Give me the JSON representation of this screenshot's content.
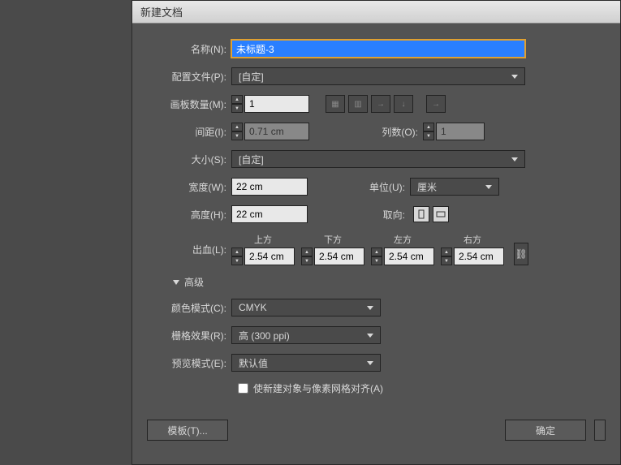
{
  "title": "新建文档",
  "name": {
    "label": "名称(N):",
    "value": "未标题-3"
  },
  "profile": {
    "label": "配置文件(P):",
    "value": "[自定]"
  },
  "artboards": {
    "label": "画板数量(M):",
    "value": "1"
  },
  "spacing": {
    "label": "间距(I):",
    "value": "0.71 cm"
  },
  "columns": {
    "label": "列数(O):",
    "value": "1"
  },
  "size": {
    "label": "大小(S):",
    "value": "[自定]"
  },
  "width": {
    "label": "宽度(W):",
    "value": "22 cm"
  },
  "units": {
    "label": "单位(U):",
    "value": "厘米"
  },
  "height": {
    "label": "高度(H):",
    "value": "22 cm"
  },
  "orientation": {
    "label": "取向:"
  },
  "bleed": {
    "label": "出血(L):",
    "top": {
      "label": "上方",
      "value": "2.54 cm"
    },
    "bottom": {
      "label": "下方",
      "value": "2.54 cm"
    },
    "left": {
      "label": "左方",
      "value": "2.54 cm"
    },
    "right": {
      "label": "右方",
      "value": "2.54 cm"
    }
  },
  "advanced": {
    "label": "高级"
  },
  "colormode": {
    "label": "颜色模式(C):",
    "value": "CMYK"
  },
  "raster": {
    "label": "栅格效果(R):",
    "value": "高 (300 ppi)"
  },
  "preview": {
    "label": "预览模式(E):",
    "value": "默认值"
  },
  "pixelgrid": {
    "label": "使新建对象与像素网格对齐(A)"
  },
  "buttons": {
    "template": "模板(T)...",
    "ok": "确定"
  }
}
